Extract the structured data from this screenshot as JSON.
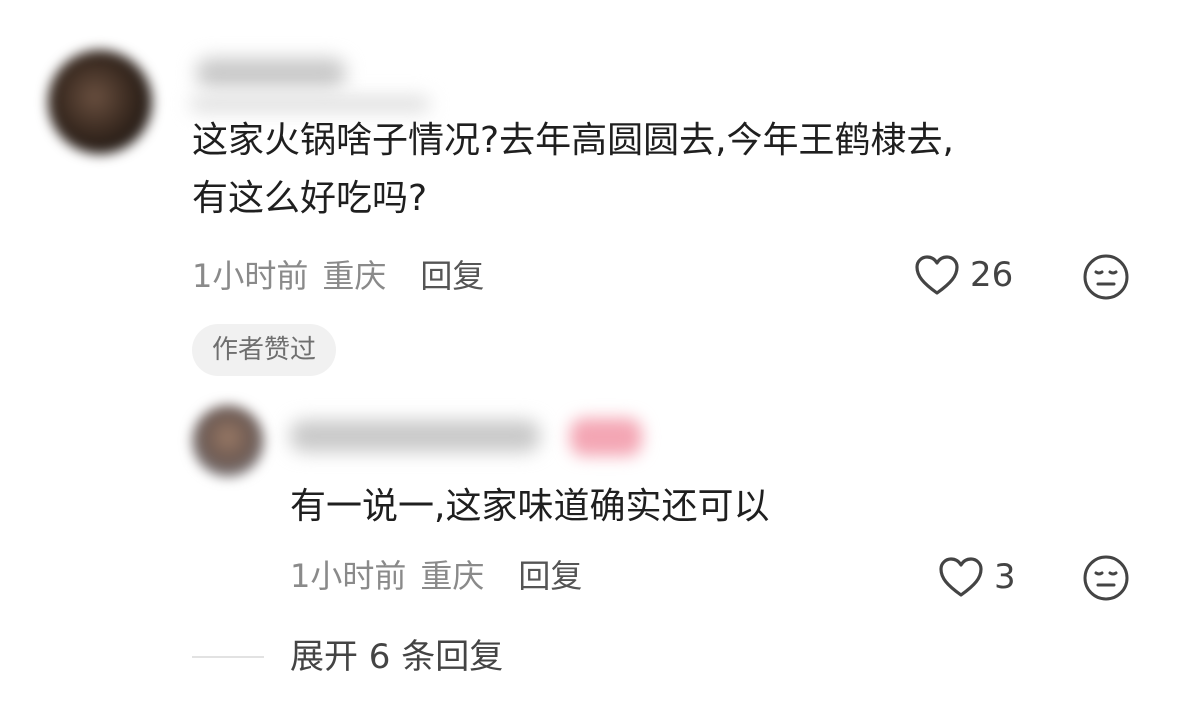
{
  "comment": {
    "text": "这家火锅啥子情况?去年高圆圆去,今年王鹤棣去,\n有这么好吃吗?",
    "time": "1小时前",
    "location": "重庆",
    "reply_label": "回复",
    "like_count": "26",
    "author_tag": "作者赞过"
  },
  "reply": {
    "text": "有一说一,这家味道确实还可以",
    "time": "1小时前",
    "location": "重庆",
    "reply_label": "回复",
    "like_count": "3"
  },
  "expand_label": "展开 6 条回复",
  "icons": {
    "like": "heart-outline-icon",
    "dislike": "meh-face-icon"
  },
  "colors": {
    "text": "#1f1f1f",
    "meta": "#8a8a8a",
    "tag_bg": "#f1f1f1"
  }
}
